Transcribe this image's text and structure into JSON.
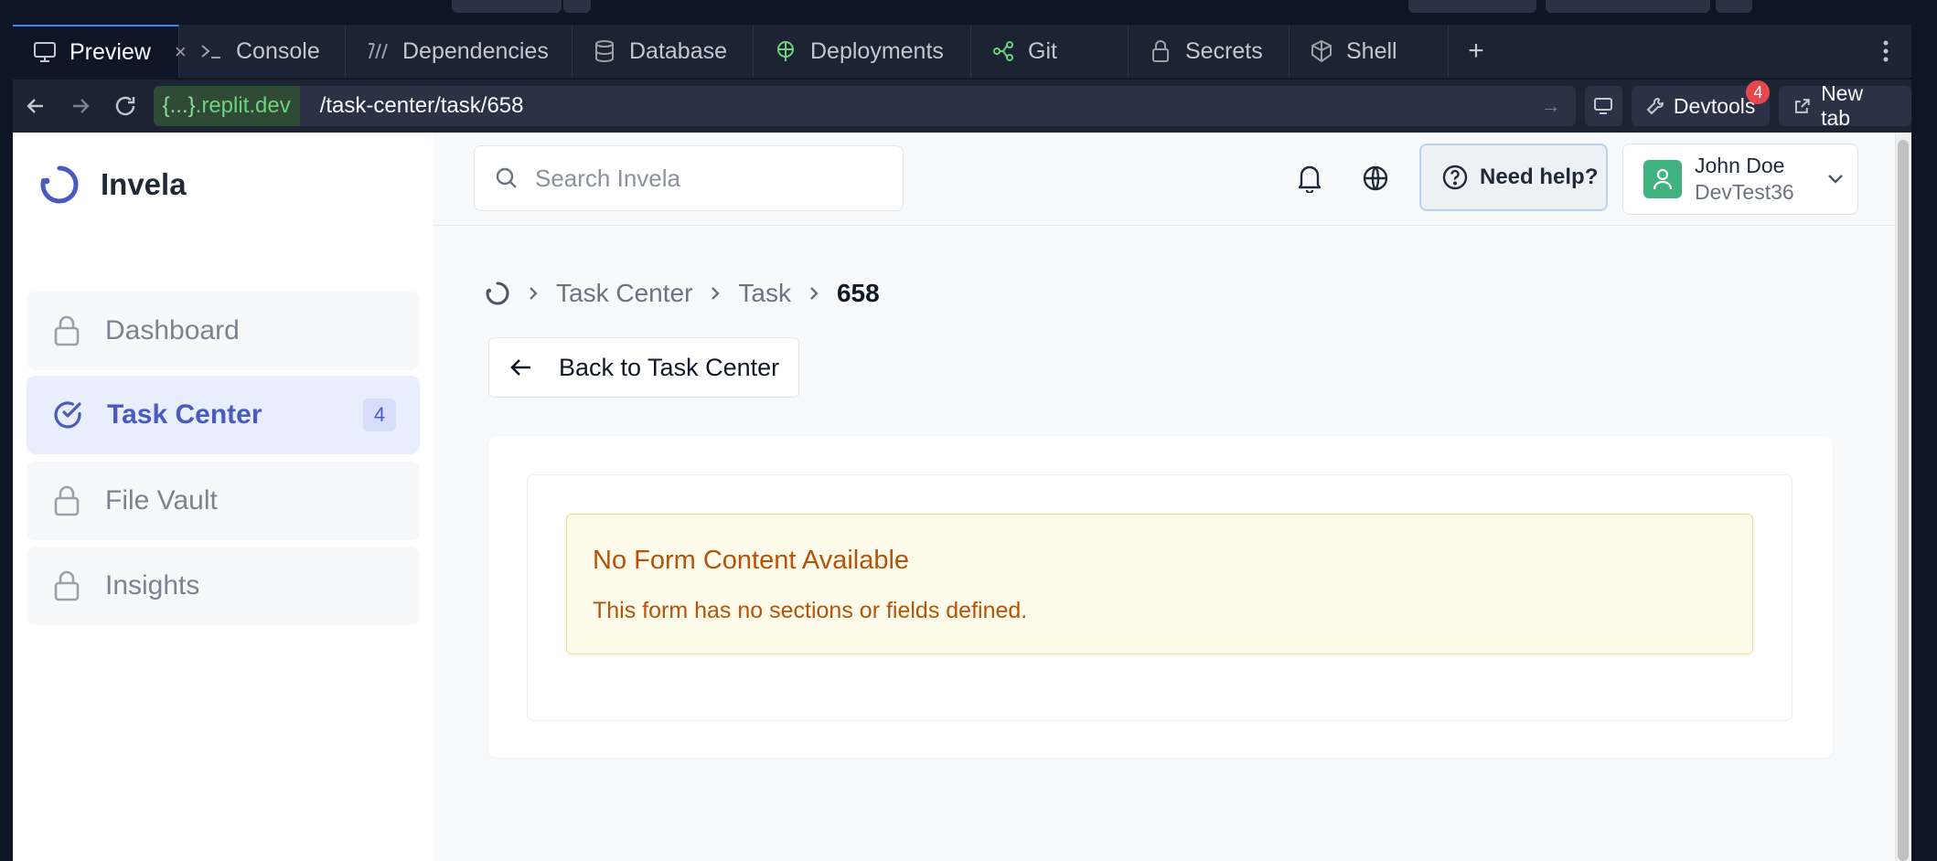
{
  "tabs": [
    {
      "label": "Preview",
      "icon": "monitor-icon",
      "active": true
    },
    {
      "label": "Console",
      "icon": "terminal-icon"
    },
    {
      "label": "Dependencies",
      "icon": "dependencies-icon"
    },
    {
      "label": "Database",
      "icon": "database-icon"
    },
    {
      "label": "Deployments",
      "icon": "deployments-icon"
    },
    {
      "label": "Git",
      "icon": "git-icon"
    },
    {
      "label": "Secrets",
      "icon": "lock-icon"
    },
    {
      "label": "Shell",
      "icon": "shell-icon"
    }
  ],
  "address": {
    "host_prefix": "{...}",
    "host_domain": ".replit.dev",
    "path": "/task-center/task/658",
    "devtools_label": "Devtools",
    "devtools_badge": "4",
    "new_tab_label": "New tab"
  },
  "app": {
    "brand": "Invela",
    "sidebar": {
      "items": [
        {
          "label": "Dashboard",
          "icon": "lock-icon",
          "locked": true
        },
        {
          "label": "Task Center",
          "icon": "check-circle-icon",
          "active": true,
          "badge": "4"
        },
        {
          "label": "File Vault",
          "icon": "lock-icon",
          "locked": true
        },
        {
          "label": "Insights",
          "icon": "lock-icon",
          "locked": true
        }
      ]
    },
    "header": {
      "search_placeholder": "Search Invela",
      "help_label": "Need help?",
      "user_name": "John Doe",
      "user_company": "DevTest36"
    },
    "breadcrumb": [
      "Task Center",
      "Task",
      "658"
    ],
    "back_label": "Back to Task Center",
    "alert": {
      "title": "No Form Content Available",
      "message": "This form has no sections or fields defined."
    }
  },
  "colors": {
    "accent": "#4a5bbf",
    "alert_text": "#b45309",
    "alert_bg": "#fffbea",
    "ide_bg": "#1c2333"
  }
}
